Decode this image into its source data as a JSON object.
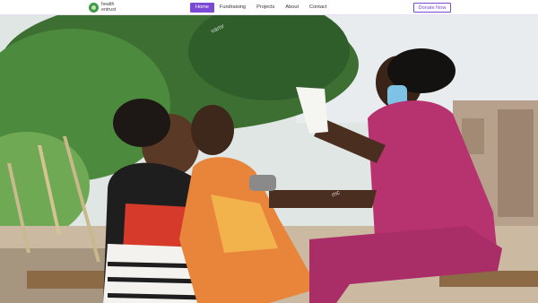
{
  "brand": {
    "name_line1": "health",
    "name_line2": "entrust"
  },
  "nav": {
    "items": [
      {
        "label": "Home",
        "active": true
      },
      {
        "label": "Fundraising"
      },
      {
        "label": "Projects"
      },
      {
        "label": "About"
      },
      {
        "label": "Contact"
      }
    ],
    "cta_label": "Donate Now"
  },
  "hero": {
    "watermarks": [
      "vamr",
      "mc"
    ]
  },
  "colors": {
    "accent": "#7b4bd6",
    "nurse_scrubs": "#b7336f",
    "foliage": "#3f7a3a"
  }
}
